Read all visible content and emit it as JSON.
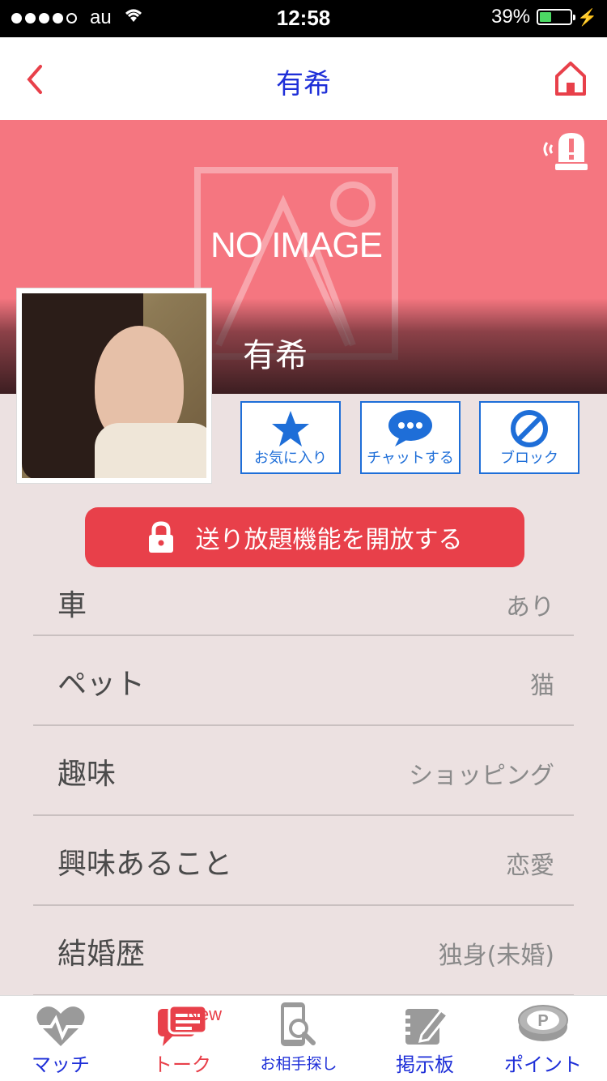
{
  "status_bar": {
    "carrier": "au",
    "time": "12:58",
    "battery": "39%",
    "battery_level": 0.39
  },
  "nav": {
    "title": "有希"
  },
  "header": {
    "placeholder_text": "NO IMAGE",
    "name": "有希"
  },
  "actions": [
    {
      "label": "お気に入り",
      "icon": "star-icon"
    },
    {
      "label": "チャットする",
      "icon": "chat-bubble-icon"
    },
    {
      "label": "ブロック",
      "icon": "block-icon"
    }
  ],
  "unlock": {
    "label": "送り放題機能を開放する"
  },
  "profile_rows": [
    {
      "label": "車",
      "value": "あり"
    },
    {
      "label": "ペット",
      "value": "猫"
    },
    {
      "label": "趣味",
      "value": "ショッピング"
    },
    {
      "label": "興味あること",
      "value": "恋愛"
    },
    {
      "label": "結婚歴",
      "value": "独身(未婚)"
    }
  ],
  "tabs": [
    {
      "label": "マッチ",
      "icon": "heartbeat-icon"
    },
    {
      "label": "トーク",
      "icon": "chat-icon",
      "badge": "New",
      "active": true
    },
    {
      "label": "お相手探し",
      "icon": "phone-search-icon"
    },
    {
      "label": "掲示板",
      "icon": "board-icon"
    },
    {
      "label": "ポイント",
      "icon": "point-icon"
    }
  ],
  "colors": {
    "accent_red": "#e8404a",
    "header_pink": "#f57680",
    "link_blue": "#1e2fd8",
    "button_blue": "#1e6ed8"
  }
}
